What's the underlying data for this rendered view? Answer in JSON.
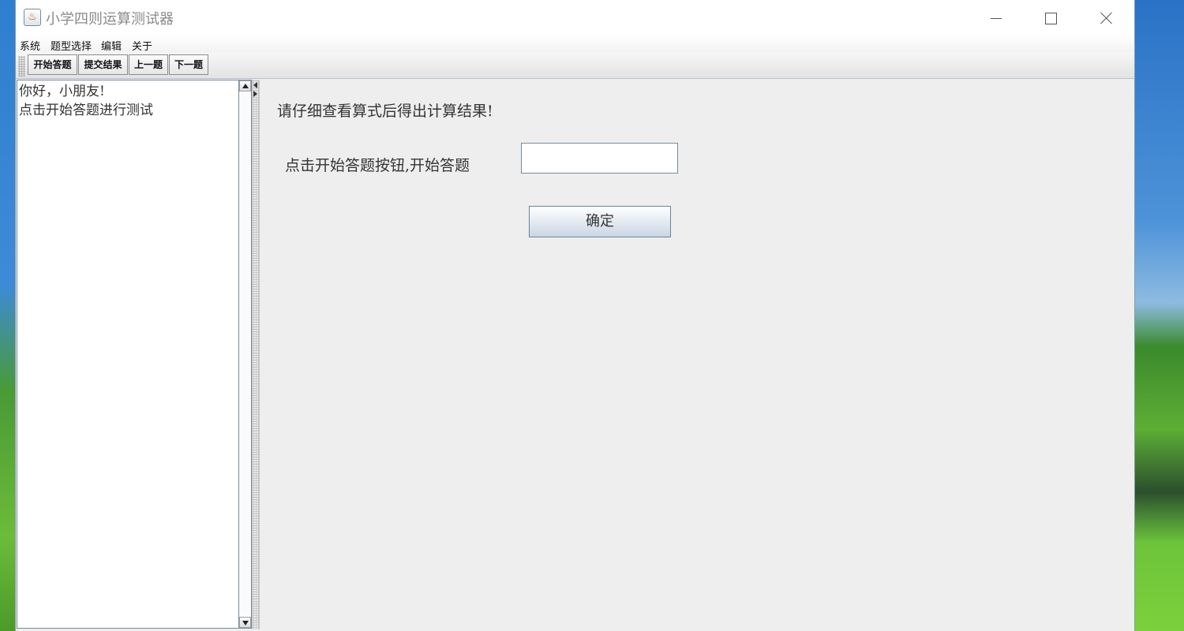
{
  "window": {
    "title": "小学四则运算测试器"
  },
  "menu": {
    "items": [
      "系统",
      "题型选择",
      "编辑",
      "关于"
    ]
  },
  "toolbar": {
    "buttons": [
      "开始答题",
      "提交结果",
      "上一题",
      "下一题"
    ]
  },
  "left_panel": {
    "lines": [
      "你好，小朋友!",
      "点击开始答题进行测试"
    ]
  },
  "main": {
    "heading": "请仔细查看算式后得出计算结果!",
    "prompt": "点击开始答题按钮,开始答题",
    "answer_value": "",
    "confirm_label": "确定"
  },
  "colors": {
    "window_bg": "#eeeeee",
    "title_text": "#8a8a8a",
    "button_gradient_bottom": "#c9d7e5"
  }
}
